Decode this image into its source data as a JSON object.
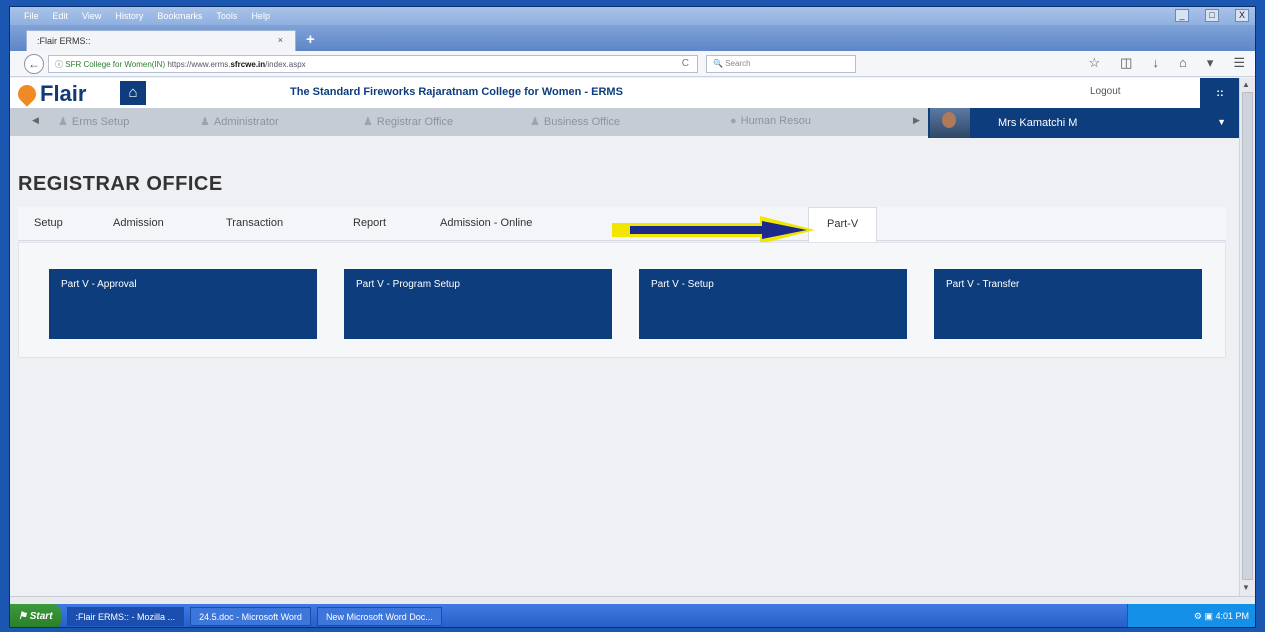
{
  "window": {
    "menu": [
      "File",
      "Edit",
      "View",
      "History",
      "Bookmarks",
      "Tools",
      "Help"
    ],
    "controls": [
      "_",
      "□",
      "X"
    ]
  },
  "browser": {
    "tab_title": ":Flair ERMS::",
    "tab_close": "×",
    "new_tab": "+",
    "url_identity": "SFR College for Women(IN)",
    "url_prefix": "https://www.erms.",
    "url_host": "sfrcwe.in",
    "url_suffix": "/index.aspx",
    "reload": "C",
    "search_placeholder": "Search"
  },
  "app": {
    "logo": "Flair",
    "college_title": "The Standard Fireworks Rajaratnam College for Women - ERMS",
    "logout": "Logout",
    "grid_icon": "::",
    "modules": [
      {
        "label": "Erms Setup"
      },
      {
        "label": "Administrator"
      },
      {
        "label": "Registrar Office"
      },
      {
        "label": "Business Office"
      },
      {
        "label": "Human Resou"
      }
    ],
    "user_name": "Mrs Kamatchi M"
  },
  "page": {
    "title": "REGISTRAR OFFICE",
    "tabs": [
      {
        "label": "Setup"
      },
      {
        "label": "Admission"
      },
      {
        "label": "Transaction"
      },
      {
        "label": "Report"
      },
      {
        "label": "Admission - Online"
      },
      {
        "label": "Part-V"
      }
    ],
    "active_tab": "Part-V",
    "tiles": [
      {
        "label": "Part V - Approval"
      },
      {
        "label": "Part V - Program Setup"
      },
      {
        "label": "Part V - Setup"
      },
      {
        "label": "Part V - Transfer"
      }
    ]
  },
  "taskbar": {
    "start": "Start",
    "tasks": [
      {
        "label": ":Flair ERMS:: - Mozilla ..."
      },
      {
        "label": "24.5.doc - Microsoft Word"
      },
      {
        "label": "New Microsoft Word Doc..."
      }
    ],
    "clock": "4:01 PM"
  },
  "colors": {
    "brand_navy": "#0e3d7e",
    "logo_orange": "#f08a24",
    "annotation_arrow_fill": "#1b2a8a",
    "annotation_arrow_outline": "#f2e600"
  }
}
